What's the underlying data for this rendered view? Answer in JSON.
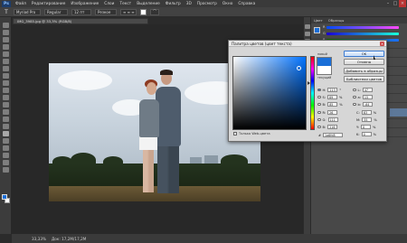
{
  "menubar": {
    "logo": "Ps",
    "items": [
      "Файл",
      "Редактирование",
      "Изображение",
      "Слои",
      "Текст",
      "Выделение",
      "Фильтр",
      "3D",
      "Просмотр",
      "Окно",
      "Справка"
    ]
  },
  "options": {
    "font_family": "Myriad Pro",
    "font_style": "Regular",
    "size": "12 пт",
    "aa": "Резкое"
  },
  "document": {
    "tab_title": "IMG_3985.jpg @ 33,3% (RGB/8)"
  },
  "status": {
    "zoom": "33,33%",
    "doc": "Док: 17,2M/17,2M"
  },
  "right_panel": {
    "tabs": [
      "Цвет",
      "Образцы"
    ],
    "sliders": [
      {
        "label": "R",
        "color": "linear-gradient(90deg,#004aff,#ff4aff)"
      },
      {
        "label": "G",
        "color": "linear-gradient(90deg,#1a00d8,#1affd8)"
      },
      {
        "label": "B",
        "color": "linear-gradient(90deg,#1a6f00,#1a6fff)"
      }
    ]
  },
  "dialog": {
    "title": "Палитра цветов (цвет текста)",
    "new_label": "новый",
    "old_label": "текущий",
    "buttons": {
      "ok": "OK",
      "cancel": "Отмена",
      "add": "Добавить в образцы",
      "libs": "Библиотеки цветов"
    },
    "fields": {
      "H": {
        "label": "H:",
        "value": "213",
        "unit": "°"
      },
      "S": {
        "label": "S:",
        "value": "89",
        "unit": "%"
      },
      "B": {
        "label": "B:",
        "value": "85",
        "unit": "%"
      },
      "R": {
        "label": "R:",
        "value": "26"
      },
      "G": {
        "label": "G:",
        "value": "111"
      },
      "Bl": {
        "label": "B:",
        "value": "216"
      },
      "L": {
        "label": "L:",
        "value": "47"
      },
      "a": {
        "label": "a:",
        "value": "15"
      },
      "b": {
        "label": "b:",
        "value": "-64"
      },
      "C": {
        "label": "C:",
        "value": "83",
        "unit": "%"
      },
      "M": {
        "label": "M:",
        "value": "55",
        "unit": "%"
      },
      "Y": {
        "label": "Y:",
        "value": "0",
        "unit": "%"
      },
      "K": {
        "label": "K:",
        "value": "0",
        "unit": "%"
      }
    },
    "web_only": "Только Web-цвета",
    "hex_label": "#",
    "hex_value": "1a6fd8"
  },
  "colors": {
    "foreground": "#1a6fd8",
    "background": "#ffffff",
    "accent": "#3d7bd0"
  }
}
